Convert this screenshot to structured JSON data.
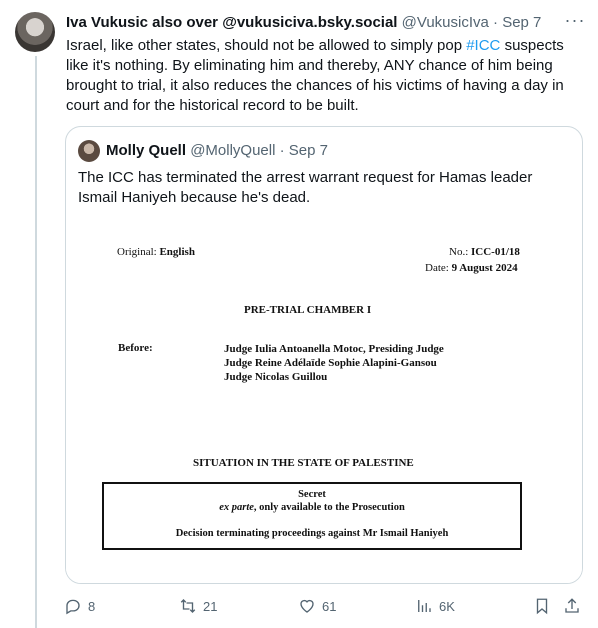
{
  "tweet": {
    "author_name": "Iva Vukusic also over @vukusiciva.bsky.social",
    "handle": "@VukusicIva",
    "separator": " · ",
    "date": "Sep 7",
    "more": "···",
    "text_before": "Israel, like other states, should not be allowed to simply pop ",
    "hashtag": "#ICC",
    "text_after": " suspects like it's nothing. By eliminating him and thereby, ANY chance of him being brought to trial, it also reduces the chances of his victims of having a day in court and for the historical record to be built."
  },
  "quote": {
    "author_name": "Molly Quell",
    "handle": "@MollyQuell",
    "separator": " · ",
    "date": "Sep 7",
    "text": "The ICC has terminated the arrest warrant request for Hamas leader Ismail Haniyeh because he's dead."
  },
  "document": {
    "original_label": "Original: ",
    "original_value": "English",
    "no_label": "No.: ",
    "no_value": "ICC-01/18",
    "date_label": "Date: ",
    "date_value": "9 August 2024",
    "chamber": "PRE-TRIAL CHAMBER I",
    "before": "Before:",
    "judge1": "Judge Iulia Antoanella Motoc, Presiding Judge",
    "judge2": "Judge Reine Adélaïde Sophie Alapini-Gansou",
    "judge3": "Judge Nicolas Guillou",
    "situation": "SITUATION IN THE STATE OF PALESTINE",
    "secret": "Secret",
    "exparte_italic": "ex parte",
    "exparte_rest": ", only available to the Prosecution",
    "decision": "Decision terminating proceedings against Mr Ismail Haniyeh"
  },
  "actions": {
    "replies": "8",
    "reposts": "21",
    "likes": "61",
    "views": "6K"
  }
}
